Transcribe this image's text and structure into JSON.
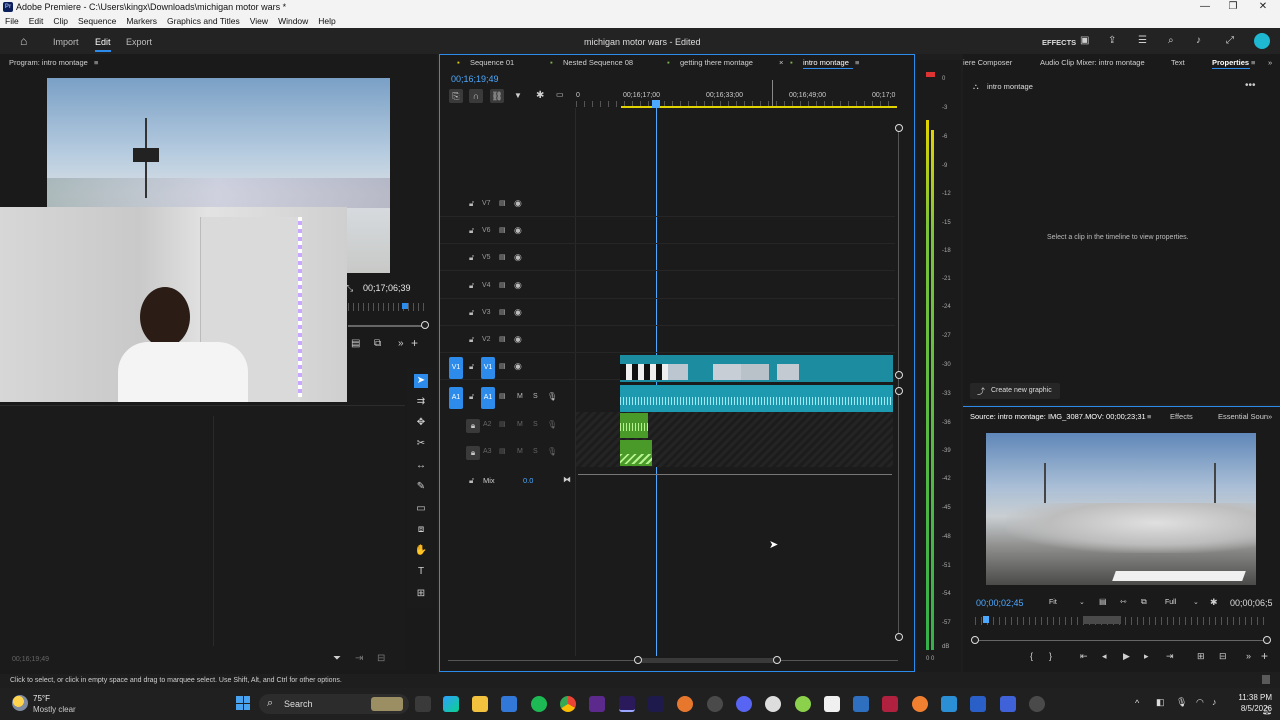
{
  "window": {
    "title": "Adobe Premiere - C:\\Users\\kingx\\Downloads\\michigan motor wars *",
    "minimize": "—",
    "restore": "❐",
    "close": "✕"
  },
  "menu": [
    "File",
    "Edit",
    "Clip",
    "Sequence",
    "Markers",
    "Graphics and Titles",
    "View",
    "Window",
    "Help"
  ],
  "workspace": {
    "import": "Import",
    "edit": "Edit",
    "export": "Export",
    "project_title": "michigan motor wars",
    "status": "- Edited",
    "effects_label": "EFFECTS"
  },
  "program_monitor": {
    "title": "Program: intro montage",
    "timecode": "00;17;06;39",
    "bottom_timecode": "00;16;19;49"
  },
  "timeline": {
    "tabs": [
      "Sequence 01",
      "Nested Sequence 08",
      "getting there montage",
      "intro montage"
    ],
    "timecode": "00;16;19;49",
    "ruler": [
      "0",
      "00;16;17;00",
      "00;16;33;00",
      "00;16;49;00",
      "00;17;0"
    ],
    "video_tracks": [
      "V7",
      "V6",
      "V5",
      "V4",
      "V3",
      "V2",
      "V1"
    ],
    "audio_tracks": [
      "A1",
      "A2",
      "A3"
    ],
    "mix_label": "Mix",
    "mix_value": "0.0",
    "m": "M",
    "s": "S"
  },
  "meter": {
    "ticks": [
      "0",
      "-3",
      "-6",
      "-9",
      "-12",
      "-15",
      "-18",
      "-21",
      "-24",
      "-27",
      "-30",
      "-33",
      "-36",
      "-39",
      "-42",
      "-45",
      "-48",
      "-51",
      "-54",
      "-57",
      "dB"
    ],
    "bottom": "0 0"
  },
  "right_panel": {
    "tabs": [
      "iere Composer",
      "Audio Clip Mixer: intro montage",
      "Text",
      "Properties"
    ],
    "sequence_name": "intro montage",
    "empty_msg": "Select a clip in the timeline to view properties.",
    "create_graphic": "Create new graphic"
  },
  "source_monitor": {
    "tabs": [
      "Source: intro montage: IMG_3087.MOV: 00;00;23;31",
      "Effects",
      "Essential Soun"
    ],
    "timecode": "00;00;02;45",
    "fit": "Fit",
    "full": "Full",
    "end_timecode": "00;00;06;5"
  },
  "statusbar": {
    "hint": "Click to select, or click in empty space and drag to marquee select. Use Shift, Alt, and Ctrl for other options."
  },
  "taskbar": {
    "temp": "75°F",
    "weather": "Mostly clear",
    "search": "Search",
    "time": "11:38 PM",
    "date": "8/5/2026"
  },
  "colors": {
    "accent_blue": "#2d8ceb",
    "clip_video": "#1c8ca0",
    "clip_audio": "#1e9ab0",
    "clip_green": "#4a9a2a",
    "yellow": "#e2d300"
  }
}
